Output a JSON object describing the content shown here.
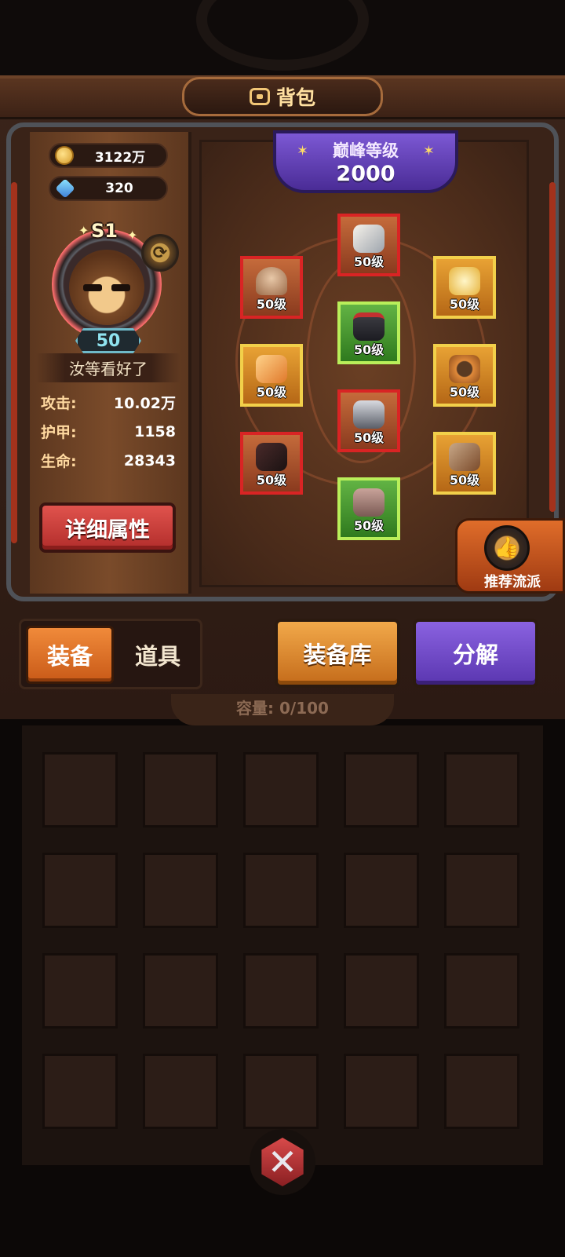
{
  "header": {
    "title": "背包",
    "icon": "bag-icon"
  },
  "currencies": [
    {
      "icon": "coin-icon",
      "value": "3122万"
    },
    {
      "icon": "gem-icon",
      "value": "320"
    }
  ],
  "hero": {
    "rank": "S1",
    "level": "50",
    "name": "汝等看好了",
    "stats": [
      {
        "label": "攻击:",
        "value": "10.02万"
      },
      {
        "label": "护甲:",
        "value": "1158"
      },
      {
        "label": "生命:",
        "value": "28343"
      }
    ],
    "detail_button": "详细属性"
  },
  "peak": {
    "label": "巅峰等级",
    "value": "2000"
  },
  "equipment": {
    "helmet": "50级",
    "gloves": "50级",
    "weapon": "50级",
    "head_top": "50级",
    "armor": "50级",
    "pants": "50级",
    "boots": "50级",
    "necklace": "50级",
    "belt": "50级",
    "quiver": "50级"
  },
  "recommend_button": "推荐流派",
  "tabs": {
    "equipment": "装备",
    "items": "道具"
  },
  "buttons": {
    "library": "装备库",
    "decompose": "分解"
  },
  "capacity": "容量: 0/100",
  "colors": {
    "red_rarity": "#d92424",
    "orange_rarity": "#f2d04a",
    "green_rarity": "#b9ef5a",
    "purple_accent": "#6a48c8"
  }
}
